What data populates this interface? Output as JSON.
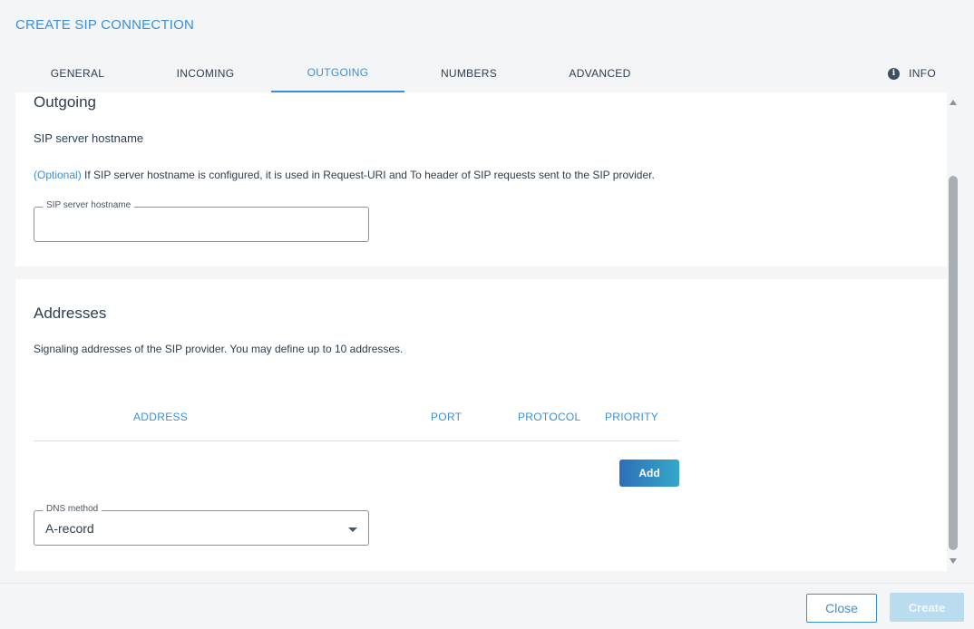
{
  "dialog": {
    "title": "CREATE SIP CONNECTION"
  },
  "tabs": [
    {
      "label": "GENERAL"
    },
    {
      "label": "INCOMING"
    },
    {
      "label": "OUTGOING",
      "active": true
    },
    {
      "label": "NUMBERS"
    },
    {
      "label": "ADVANCED"
    }
  ],
  "info_tab": {
    "label": "INFO",
    "icon": "info-icon"
  },
  "outgoing": {
    "title": "Outgoing",
    "hostname_label": "SIP server hostname",
    "optional_tag": "(Optional)",
    "hostname_desc": " If SIP server hostname is configured, it is used in Request-URI and To header of SIP requests sent to the SIP provider.",
    "hostname_field": {
      "legend": "SIP server hostname",
      "value": ""
    }
  },
  "addresses": {
    "title": "Addresses",
    "desc": "Signaling addresses of the SIP provider. You may define up to 10 addresses.",
    "columns": [
      "ADDRESS",
      "PORT",
      "PROTOCOL",
      "PRIORITY"
    ],
    "rows": [],
    "add_label": "Add",
    "dns_field": {
      "legend": "DNS method",
      "value": "A-record"
    }
  },
  "footer": {
    "close_label": "Close",
    "create_label": "Create"
  },
  "colors": {
    "accent": "#3a8fd8",
    "disabled_create": "#b9dcef"
  }
}
